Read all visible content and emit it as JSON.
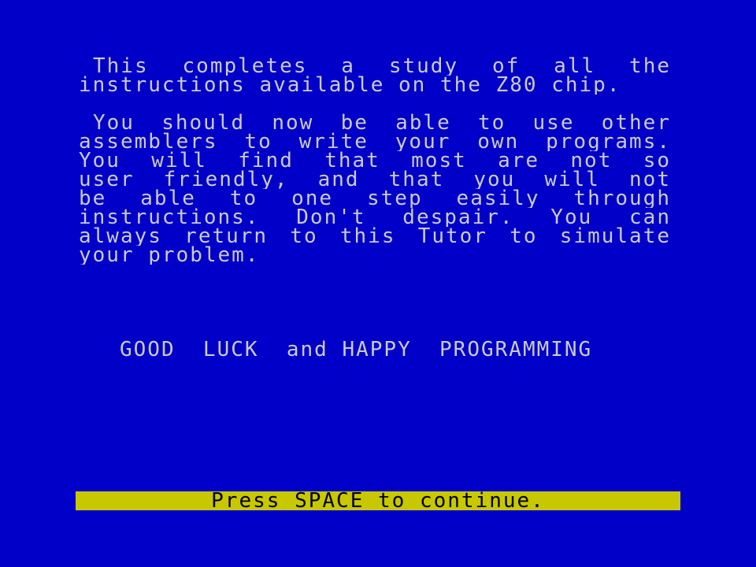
{
  "colors": {
    "background": "#0000c8",
    "text": "#cacaca",
    "prompt_bar": "#c8c800",
    "prompt_text": "#000000"
  },
  "paragraph1": {
    "lines": [
      "This completes a study of all the",
      "instructions available on the Z80 chip."
    ]
  },
  "paragraph2": {
    "lines": [
      "You should now be able to use other",
      "assemblers to write your own programs.",
      "You will find that most are not so",
      "user friendly, and that you will not",
      "be able to one step easily through",
      "instructions. Don't despair. You can",
      "always return to this Tutor to simulate",
      "your problem."
    ]
  },
  "closing": {
    "message": "GOOD  LUCK  and HAPPY  PROGRAMMING"
  },
  "prompt": {
    "label": "Press SPACE to continue."
  }
}
